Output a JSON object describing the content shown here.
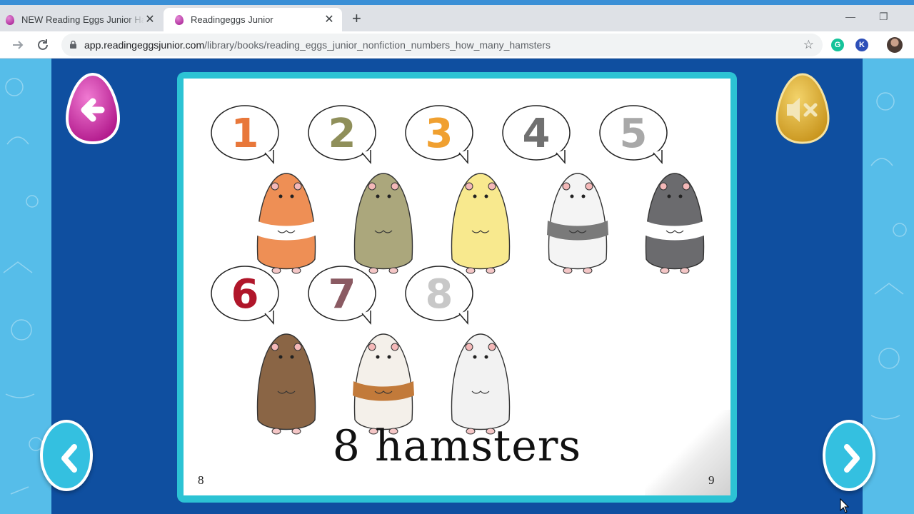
{
  "browser": {
    "tabs": [
      {
        "title": "NEW Reading Eggs Junior Has La",
        "active": false
      },
      {
        "title": "Readingeggs Junior",
        "active": true
      }
    ],
    "new_tab_icon": "+",
    "minimize_icon": "—",
    "restore_icon": "❐",
    "url_host": "app.readingeggsjunior.com",
    "url_path": "/library/books/reading_eggs_junior_nonfiction_numbers_how_many_hamsters",
    "extensions": [
      {
        "name": "grammarly-icon",
        "letter": "G",
        "color": "#15c39a"
      },
      {
        "name": "k-extension-icon",
        "letter": "K",
        "color": "#2d4fb8"
      }
    ]
  },
  "app": {
    "back_button_icon": "arrow-left-icon",
    "sound_button_icon": "mute-icon",
    "prev_button_icon": "chevron-left-icon",
    "next_button_icon": "chevron-right-icon",
    "colors": {
      "background": "#56bde9",
      "stage": "#0f4fa0",
      "book_frame": "#2cc3d4",
      "back_egg": "#d43aa8",
      "sound_egg": "#e2b22a"
    }
  },
  "book": {
    "numbers": [
      {
        "label": "1",
        "color": "#e8773a",
        "hamster": "orange-banded"
      },
      {
        "label": "2",
        "color": "#8f8f5a",
        "hamster": "olive"
      },
      {
        "label": "3",
        "color": "#f0a030",
        "hamster": "yellow"
      },
      {
        "label": "4",
        "color": "#707070",
        "hamster": "spotted"
      },
      {
        "label": "5",
        "color": "#a8a8a8",
        "hamster": "grey-banded"
      },
      {
        "label": "6",
        "color": "#b0162a",
        "hamster": "brown"
      },
      {
        "label": "7",
        "color": "#8a5a62",
        "hamster": "calico"
      },
      {
        "label": "8",
        "color": "#c8c8c8",
        "hamster": "white"
      }
    ],
    "caption": "8 hamsters",
    "left_page_number": "8",
    "right_page_number": "9"
  }
}
